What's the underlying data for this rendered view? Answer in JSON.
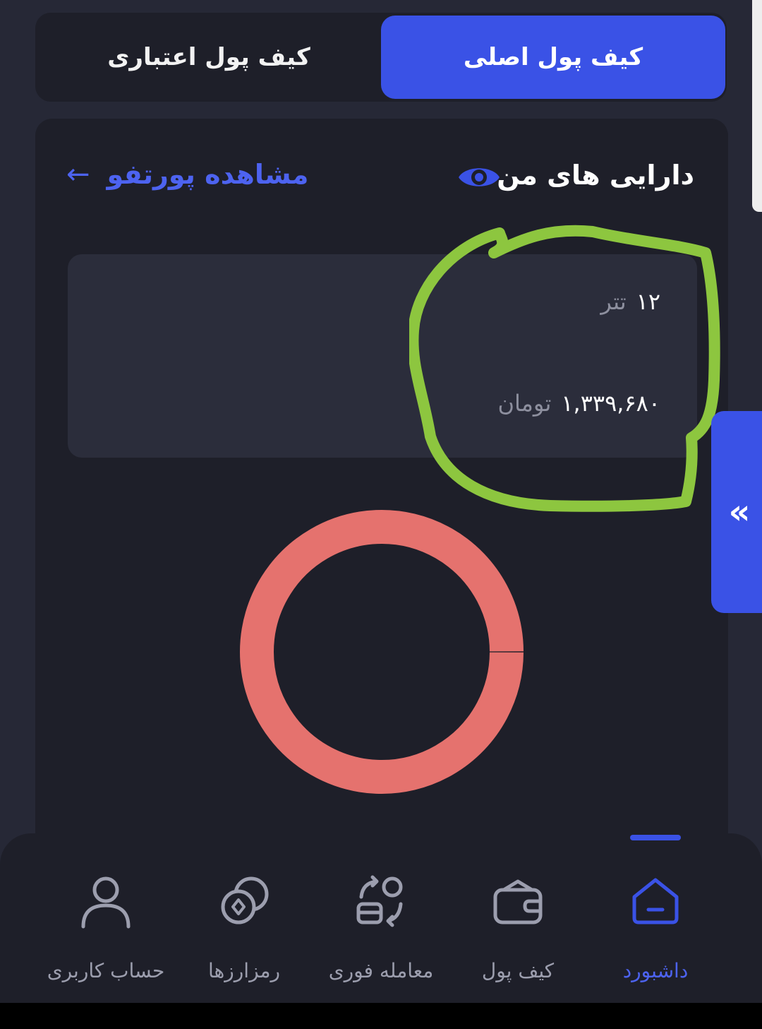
{
  "tabs": {
    "main_wallet": "کیف پول اصلی",
    "credit_wallet": "کیف پول اعتباری"
  },
  "assets": {
    "title": "دارایی های من",
    "portfolio_link": "مشاهده پورتفو",
    "eye_icon": "eye-icon",
    "arrow_icon": "arrow-left-icon"
  },
  "balances": {
    "tether_amount": "۱۲",
    "tether_unit": "تتر",
    "toman_amount": "۱,۳۳۹,۶۸۰",
    "toman_unit": "تومان"
  },
  "chart_data": {
    "type": "pie",
    "categories": [
      "تتر"
    ],
    "values": [
      100
    ],
    "colors": [
      "#e5726e"
    ]
  },
  "side_handle": {
    "icon": "double-chevron-left-icon",
    "glyph": "«"
  },
  "bottom_nav": {
    "dashboard": "داشبورد",
    "wallet": "کیف پول",
    "instant_trade": "معامله فوری",
    "cryptos": "رمزارزها",
    "account": "حساب کاربری"
  },
  "colors": {
    "accent": "#3a52e6",
    "highlight": "#8dc63f",
    "donut": "#e5726e"
  }
}
